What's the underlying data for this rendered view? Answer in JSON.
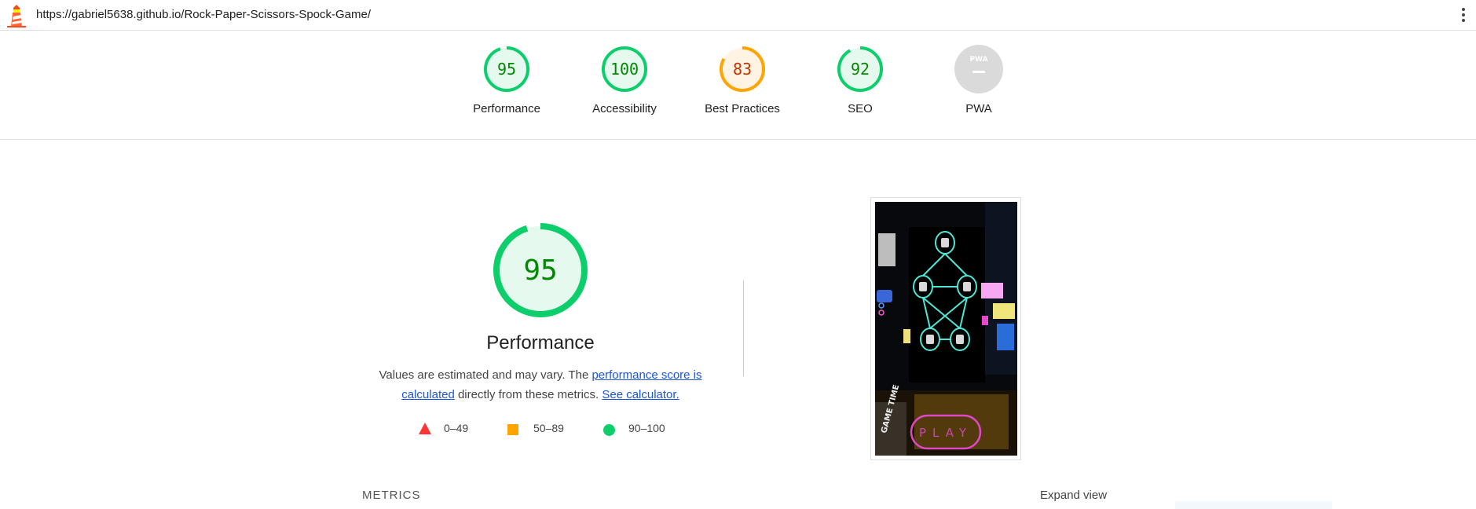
{
  "browser": {
    "url": "https://gabriel5638.github.io/Rock-Paper-Scissors-Spock-Game/"
  },
  "scores": [
    {
      "name": "Performance",
      "value": "95",
      "fraction": 0.95,
      "color": "#0cce6b",
      "text_color": "#008800",
      "bg": "#e6f9ee"
    },
    {
      "name": "Accessibility",
      "value": "100",
      "fraction": 1.0,
      "color": "#0cce6b",
      "text_color": "#008800",
      "bg": "#e6f9ee"
    },
    {
      "name": "Best Practices",
      "value": "83",
      "fraction": 0.83,
      "color": "#ffa400",
      "text_color": "#c33300",
      "bg": "#fff4e3"
    },
    {
      "name": "SEO",
      "value": "92",
      "fraction": 0.92,
      "color": "#0cce6b",
      "text_color": "#008800",
      "bg": "#e6f9ee"
    },
    {
      "name": "PWA",
      "value": "PWA",
      "fraction": null,
      "color": "#dadada",
      "text_color": "#ffffff",
      "bg": "#dadada"
    }
  ],
  "performance": {
    "score": "95",
    "fraction": 0.95,
    "title": "Performance",
    "desc_text_1": "Values are estimated and may vary. The ",
    "desc_link_1": "performance score is calculated",
    "desc_text_2": " directly from these metrics. ",
    "desc_link_2": "See calculator."
  },
  "legend": [
    {
      "range": "0–49",
      "shape": "triangle",
      "color": "#ff3333"
    },
    {
      "range": "50–89",
      "shape": "square",
      "color": "#ffa400"
    },
    {
      "range": "90–100",
      "shape": "circle",
      "color": "#0cce6b"
    }
  ],
  "thumbnail": {
    "side_text": "GAME TIME",
    "button_text": "PLAY"
  },
  "sections": {
    "metrics_label": "METRICS",
    "expand_label": "Expand view"
  }
}
